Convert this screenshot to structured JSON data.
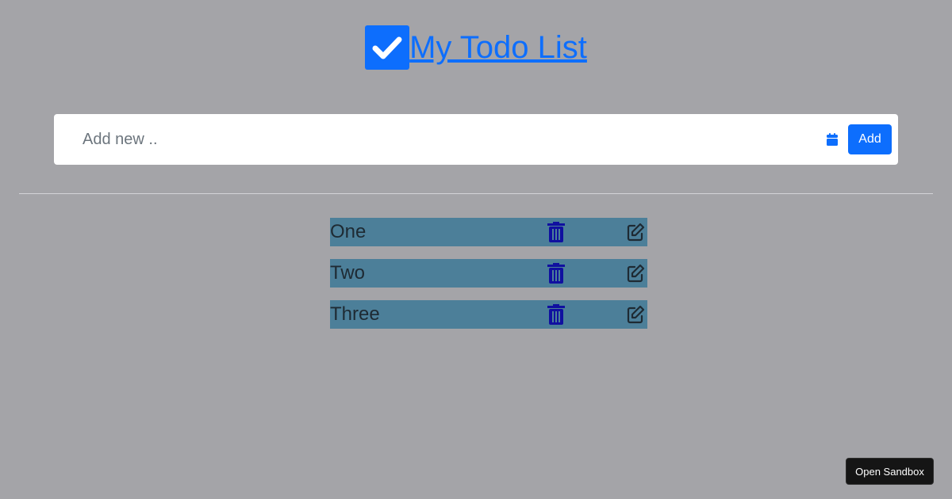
{
  "header": {
    "title": "My Todo List",
    "logo_icon": "check-square-icon"
  },
  "add_form": {
    "placeholder": "Add new ..",
    "value": "",
    "calendar_icon": "calendar-icon",
    "add_label": "Add"
  },
  "todos": [
    {
      "text": "One",
      "delete_icon": "trash-icon",
      "edit_icon": "edit-icon"
    },
    {
      "text": "Two",
      "delete_icon": "trash-icon",
      "edit_icon": "edit-icon"
    },
    {
      "text": "Three",
      "delete_icon": "trash-icon",
      "edit_icon": "edit-icon"
    }
  ],
  "footer": {
    "sandbox_label": "Open Sandbox"
  },
  "colors": {
    "background": "#a4a4a8",
    "accent": "#0d6efd",
    "todo_row": "#4c7f99",
    "trash_icon": "#1010a0",
    "edit_icon": "#1e2a33",
    "sandbox_button": "#151515"
  }
}
